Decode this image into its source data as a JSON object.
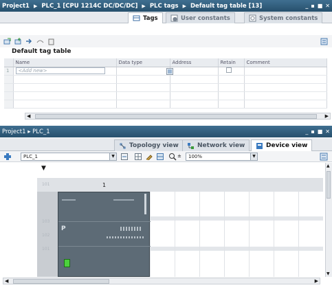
{
  "window1": {
    "breadcrumb": [
      "Project1",
      "PLC_1 [CPU 1214C DC/DC/DC]",
      "PLC tags",
      "Default tag table [13]"
    ],
    "controls": [
      "_",
      "▪",
      "■",
      "✕"
    ]
  },
  "tag_tabs": [
    {
      "label": "Tags",
      "active": true
    },
    {
      "label": "User constants",
      "active": false
    },
    {
      "label": "System constants",
      "active": false
    }
  ],
  "table": {
    "title": "Default tag table",
    "columns": [
      "Name",
      "Data type",
      "Address",
      "Retain",
      "Comment"
    ],
    "row_number": "1",
    "add_new_placeholder": "<Add new>"
  },
  "window2": {
    "title": "Project1 ▸ PLC_1",
    "controls": [
      "_",
      "▪",
      "■",
      "✕"
    ]
  },
  "view_tabs": [
    {
      "label": "Topology view",
      "active": false
    },
    {
      "label": "Network view",
      "active": false
    },
    {
      "label": "Device view",
      "active": true
    }
  ],
  "device_toolbar": {
    "device_select": "PLC_1",
    "zoom": "100%"
  },
  "rack": {
    "slot_label": "1",
    "side_labels": [
      "101",
      "103",
      "102",
      "101"
    ]
  },
  "colors": {
    "titlebar": "#2f5a7a",
    "plc_body": "#5d6b76",
    "plc_green": "#4cd13c"
  }
}
